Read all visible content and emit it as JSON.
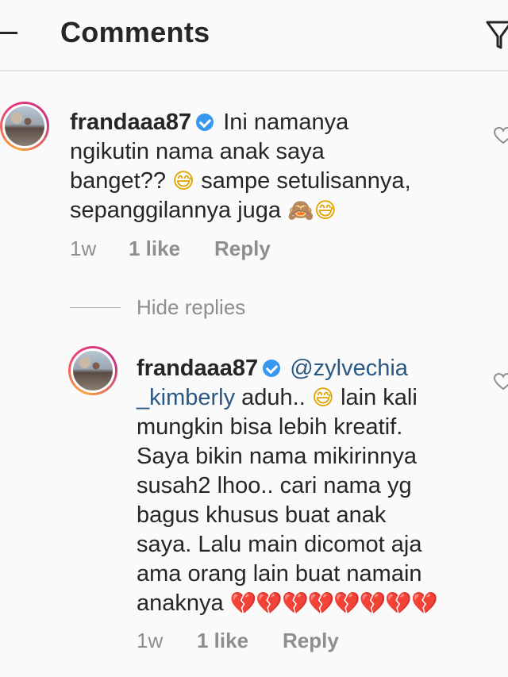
{
  "header": {
    "title": "Comments",
    "back_icon": "back-arrow-icon",
    "filter_icon": "filter-icon"
  },
  "comments": [
    {
      "username": "frandaaa87",
      "verified": true,
      "text_lines": [
        "Ini namanya",
        "ngikutin nama anak saya",
        "banget??",
        "sampe setulisannya,",
        "sepanggilannya juga"
      ],
      "emojis": [
        "grinning-sweat-emoji",
        "see-no-evil-monkey-emoji",
        "grinning-sweat-emoji"
      ],
      "time": "1w",
      "likes": "1 like",
      "reply_label": "Reply"
    }
  ],
  "hide_replies_label": "Hide replies",
  "replies": [
    {
      "username": "frandaaa87",
      "verified": true,
      "mention": "@zylvechia",
      "mention_cont": "_kimberly",
      "text_lines": [
        "aduh..",
        "lain kali",
        "mungkin bisa lebih kreatif.",
        "Saya bikin nama mikirinnya",
        "susah2 lhoo.. cari nama yg",
        "bagus khusus buat anak",
        "saya. Lalu main dicomot aja",
        "ama orang lain buat namain",
        "anaknya"
      ],
      "emojis": [
        "grinning-sweat-emoji",
        "broken-heart-emoji"
      ],
      "broken_heart_count": 8,
      "time": "1w",
      "likes": "1 like",
      "reply_label": "Reply"
    }
  ],
  "colors": {
    "background": "#fafafa",
    "text": "#262626",
    "muted": "#8e8e8e",
    "verified": "#3897f0",
    "mention": "#2a5885"
  }
}
